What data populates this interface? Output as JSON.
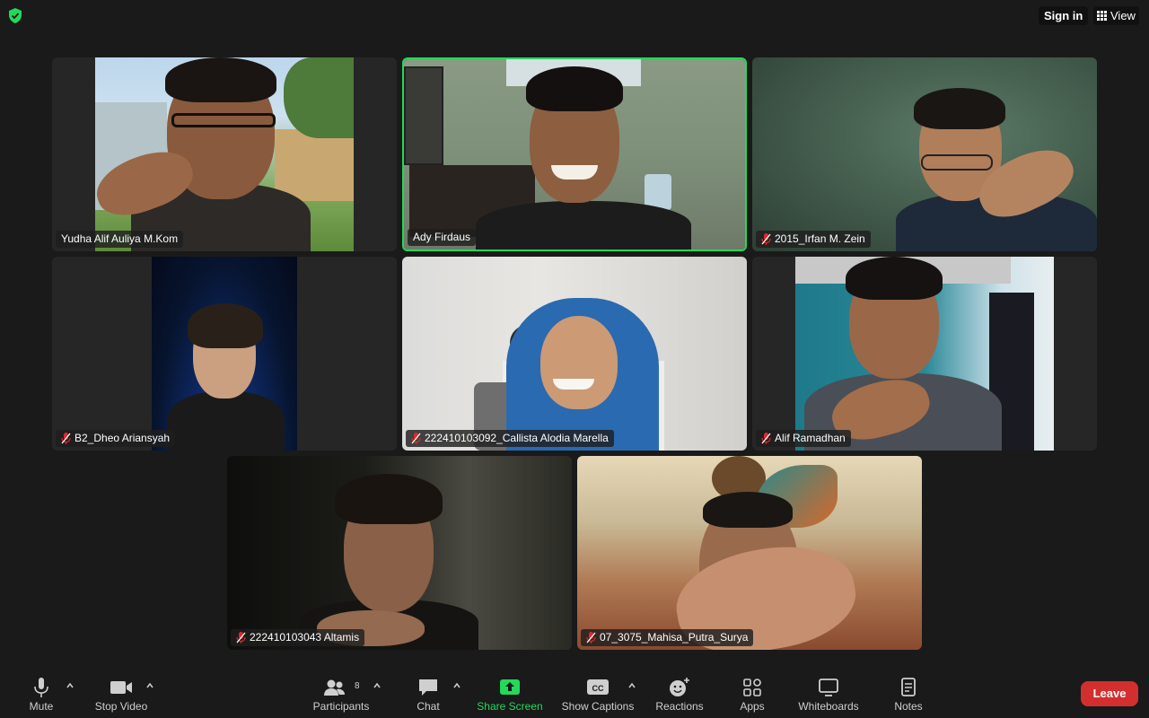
{
  "topbar": {
    "shield_icon": "shield-check-icon",
    "signin_label": "Sign in",
    "view_label": "View"
  },
  "participants": [
    {
      "name": "Yudha Alif Auliya M.Kom",
      "muted": false,
      "active": false
    },
    {
      "name": "Ady Firdaus",
      "muted": false,
      "active": true
    },
    {
      "name": "2015_Irfan M. Zein",
      "muted": true,
      "active": false
    },
    {
      "name": "B2_Dheo Ariansyah",
      "muted": true,
      "active": false
    },
    {
      "name": "222410103092_Callista Alodia Marella",
      "muted": true,
      "active": false
    },
    {
      "name": "Alif Ramadhan",
      "muted": true,
      "active": false
    },
    {
      "name": "222410103043 Altamis",
      "muted": true,
      "active": false
    },
    {
      "name": "07_3075_Mahisa_Putra_Surya",
      "muted": true,
      "active": false
    }
  ],
  "toolbar": {
    "mute_label": "Mute",
    "stop_video_label": "Stop Video",
    "participants_label": "Participants",
    "participants_count": "8",
    "chat_label": "Chat",
    "share_screen_label": "Share Screen",
    "show_captions_label": "Show Captions",
    "reactions_label": "Reactions",
    "apps_label": "Apps",
    "whiteboards_label": "Whiteboards",
    "notes_label": "Notes",
    "leave_label": "Leave"
  },
  "colors": {
    "background": "#1a1a1a",
    "active_speaker_border": "#23d959",
    "share_screen_green": "#23d959",
    "leave_red": "#d32f2f",
    "muted_mic_red": "#e02828"
  }
}
